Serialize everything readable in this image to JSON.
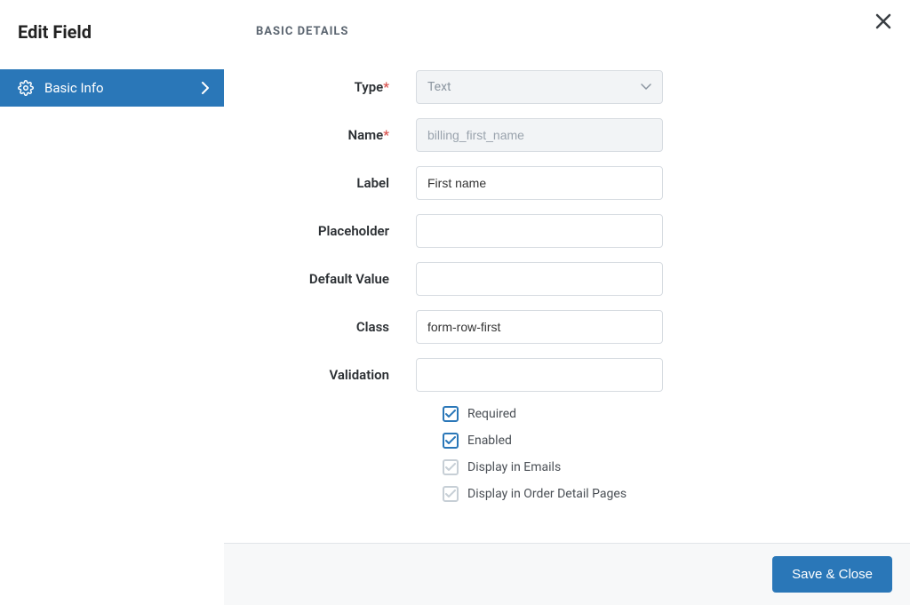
{
  "sidebar": {
    "title": "Edit Field",
    "items": [
      {
        "label": "Basic Info"
      }
    ]
  },
  "section": {
    "title": "BASIC DETAILS"
  },
  "fields": {
    "type": {
      "label": "Type",
      "required": true,
      "value": "Text"
    },
    "name": {
      "label": "Name",
      "required": true,
      "value": "billing_first_name"
    },
    "label_field": {
      "label": "Label",
      "value": "First name"
    },
    "placeholder": {
      "label": "Placeholder",
      "value": ""
    },
    "default_value": {
      "label": "Default Value",
      "value": ""
    },
    "class": {
      "label": "Class",
      "value": "form-row-first"
    },
    "validation": {
      "label": "Validation",
      "value": ""
    }
  },
  "checkboxes": {
    "required": {
      "label": "Required"
    },
    "enabled": {
      "label": "Enabled"
    },
    "display_emails": {
      "label": "Display in Emails"
    },
    "display_order": {
      "label": "Display in Order Detail Pages"
    }
  },
  "footer": {
    "save_close": "Save & Close"
  }
}
